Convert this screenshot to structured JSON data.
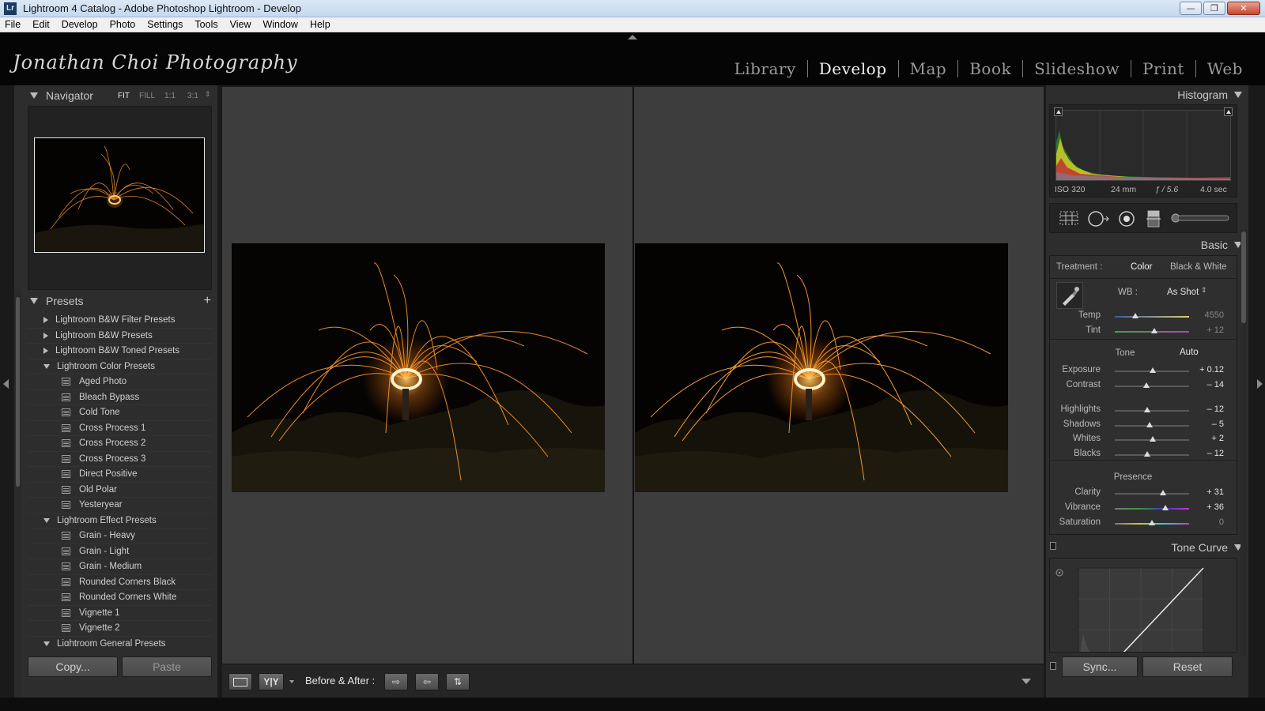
{
  "window": {
    "app_icon": "Lr",
    "title": "Lightroom 4 Catalog - Adobe Photoshop Lightroom - Develop",
    "buttons": {
      "minimize": "—",
      "restore": "❐",
      "close": "✕"
    }
  },
  "menu": [
    "File",
    "Edit",
    "Develop",
    "Photo",
    "Settings",
    "Tools",
    "View",
    "Window",
    "Help"
  ],
  "identity_plate": "Jonathan Choi Photography",
  "modules": [
    "Library",
    "Develop",
    "Map",
    "Book",
    "Slideshow",
    "Print",
    "Web"
  ],
  "active_module": "Develop",
  "navigator": {
    "title": "Navigator",
    "zoom": [
      "FIT",
      "FILL",
      "1:1",
      "3:1"
    ],
    "active_zoom": "FIT",
    "stepper_icon": "updown-icon"
  },
  "presets": {
    "title": "Presets",
    "add": "+",
    "rows": [
      {
        "type": "folder",
        "open": false,
        "label": "Lightroom B&W Filter Presets"
      },
      {
        "type": "folder",
        "open": false,
        "label": "Lightroom B&W Presets"
      },
      {
        "type": "folder",
        "open": false,
        "label": "Lightroom B&W Toned Presets"
      },
      {
        "type": "folder",
        "open": true,
        "label": "Lightroom Color Presets"
      },
      {
        "type": "item",
        "label": "Aged Photo"
      },
      {
        "type": "item",
        "label": "Bleach Bypass"
      },
      {
        "type": "item",
        "label": "Cold Tone"
      },
      {
        "type": "item",
        "label": "Cross Process 1"
      },
      {
        "type": "item",
        "label": "Cross Process 2"
      },
      {
        "type": "item",
        "label": "Cross Process 3"
      },
      {
        "type": "item",
        "label": "Direct Positive"
      },
      {
        "type": "item",
        "label": "Old Polar"
      },
      {
        "type": "item",
        "label": "Yesteryear"
      },
      {
        "type": "folder",
        "open": true,
        "label": "Lightroom Effect Presets"
      },
      {
        "type": "item",
        "label": "Grain - Heavy"
      },
      {
        "type": "item",
        "label": "Grain - Light"
      },
      {
        "type": "item",
        "label": "Grain - Medium"
      },
      {
        "type": "item",
        "label": "Rounded Corners Black"
      },
      {
        "type": "item",
        "label": "Rounded Corners White"
      },
      {
        "type": "item",
        "label": "Vignette 1"
      },
      {
        "type": "item",
        "label": "Vignette 2"
      },
      {
        "type": "folder",
        "open": true,
        "label": "Lightroom General Presets"
      }
    ]
  },
  "left_buttons": {
    "copy": "Copy...",
    "paste": "Paste"
  },
  "toolbar": {
    "view_mode_icon": "loupe-icon",
    "before_after_mode": "Y|Y",
    "before_after_label": "Before & After :",
    "copy_after_to_before_icon": "arrow-right-icon",
    "copy_before_to_after_icon": "arrow-left-icon",
    "swap_icon": "swap-icon",
    "toolbar_menu_icon": "chevron-down-icon"
  },
  "histogram": {
    "title": "Histogram",
    "exif": {
      "iso": "ISO 320",
      "focal": "24 mm",
      "aperture": "ƒ / 5.6",
      "shutter": "4.0 sec"
    }
  },
  "tools": [
    "crop-overlay-icon",
    "spot-removal-icon",
    "red-eye-icon",
    "graduated-filter-icon",
    "adjustment-brush-icon"
  ],
  "basic": {
    "title": "Basic",
    "treatment_label": "Treatment :",
    "treatment_options": [
      "Color",
      "Black & White"
    ],
    "treatment_active": "Color",
    "wb_label": "WB :",
    "wb_value": "As Shot",
    "wb_picker_icon": "eyedropper-icon",
    "wb_sliders": [
      {
        "label": "Temp",
        "value": "4550",
        "pos": 0.28
      },
      {
        "label": "Tint",
        "value": "+ 12",
        "pos": 0.53
      }
    ],
    "tone_label": "Tone",
    "tone_auto": "Auto",
    "tone_sliders": [
      {
        "label": "Exposure",
        "value": "+ 0.12",
        "pos": 0.51
      },
      {
        "label": "Contrast",
        "value": "– 14",
        "pos": 0.43
      }
    ],
    "tone_sliders2": [
      {
        "label": "Highlights",
        "value": "– 12",
        "pos": 0.44
      },
      {
        "label": "Shadows",
        "value": "– 5",
        "pos": 0.47
      },
      {
        "label": "Whites",
        "value": "+ 2",
        "pos": 0.51
      },
      {
        "label": "Blacks",
        "value": "– 12",
        "pos": 0.44
      }
    ],
    "presence_label": "Presence",
    "presence_sliders": [
      {
        "label": "Clarity",
        "value": "+ 31",
        "pos": 0.65
      },
      {
        "label": "Vibrance",
        "value": "+ 36",
        "pos": 0.68
      },
      {
        "label": "Saturation",
        "value": "0",
        "pos": 0.5
      }
    ]
  },
  "tone_curve": {
    "title": "Tone Curve",
    "target_icon": "target-adjust-icon"
  },
  "right_buttons": {
    "sync": "Sync...",
    "reset": "Reset"
  },
  "colors": {
    "accent_text": "#f2f2f2",
    "panel_bg": "#2d2d2d",
    "center_bg": "#3d3d3d",
    "spark_orange": "#ff9a2e"
  }
}
